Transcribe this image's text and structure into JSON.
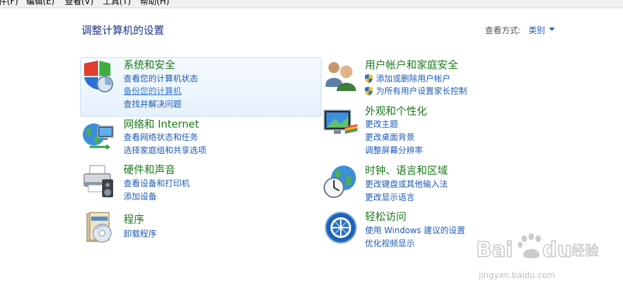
{
  "menubar": {
    "items": [
      {
        "label": "件(F)"
      },
      {
        "label": "编辑(E)"
      },
      {
        "label": "查看(V)"
      },
      {
        "label": "工具(T)"
      },
      {
        "label": "帮助(H)"
      }
    ]
  },
  "header": {
    "title": "调整计算机的设置",
    "view_label": "查看方式:",
    "view_value": "类别"
  },
  "categories": {
    "system_security": {
      "title": "系统和安全",
      "links": [
        "查看您的计算机状态",
        "备份您的计算机",
        "查找并解决问题"
      ]
    },
    "network": {
      "title": "网络和 Internet",
      "links": [
        "查看网络状态和任务",
        "选择家庭组和共享选项"
      ]
    },
    "hardware": {
      "title": "硬件和声音",
      "links": [
        "查看设备和打印机",
        "添加设备"
      ]
    },
    "programs": {
      "title": "程序",
      "links": [
        "卸载程序"
      ]
    },
    "user_accounts": {
      "title": "用户帐户和家庭安全",
      "links": [
        "添加或删除用户帐户",
        "为所有用户设置家长控制"
      ]
    },
    "appearance": {
      "title": "外观和个性化",
      "links": [
        "更改主题",
        "更改桌面背景",
        "调整屏幕分辨率"
      ]
    },
    "clock_region": {
      "title": "时钟、语言和区域",
      "links": [
        "更改键盘或其他输入法",
        "更改显示语言"
      ]
    },
    "ease_access": {
      "title": "轻松访问",
      "links": [
        "使用 Windows 建议的设置",
        "优化视频显示"
      ]
    }
  },
  "watermark": {
    "brand": "Baidu经验",
    "url": "jingyan.baidu.com"
  },
  "colors": {
    "title_green": "#1b7a1b",
    "link_blue": "#1e5bb8",
    "heading_blue": "#1e3287"
  }
}
